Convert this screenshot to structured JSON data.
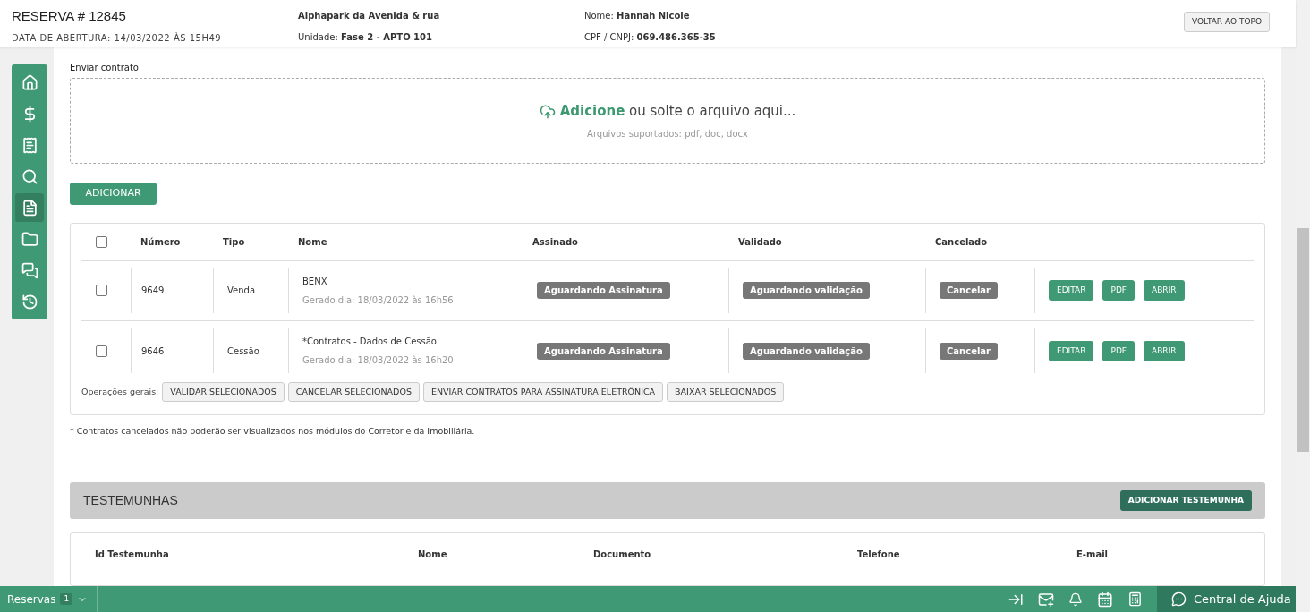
{
  "header": {
    "title": "RESERVA # 12845",
    "opened": "DATA DE ABERTURA: 14/03/2022 ÀS 15H49",
    "project": "Alphapark da Avenida & rua",
    "unit": "Unidade: **Fase 2 - APTO 101**",
    "client": "Nome: **Hannah Nicole**",
    "document": "CPF / CNPJ: **069.486.365-35**",
    "top_button": "VOLTAR AO TOPO"
  },
  "sidebar": {
    "items": [
      {
        "kind": "home",
        "selected": false
      },
      {
        "kind": "dollar",
        "selected": false
      },
      {
        "kind": "invoice",
        "selected": false
      },
      {
        "kind": "search",
        "selected": false
      },
      {
        "kind": "document",
        "selected": true
      },
      {
        "kind": "folder",
        "selected": false
      },
      {
        "kind": "chat",
        "selected": false
      },
      {
        "kind": "history",
        "selected": false
      }
    ]
  },
  "upload": {
    "label": "Enviar contrato",
    "prompt": "**Adicione** ou solte o arquivo aqui...",
    "hint": "Arquivos suportados: pdf, doc, docx"
  },
  "add_button": "ADICIONAR",
  "contracts": {
    "select_all": {
      "checked": false
    },
    "columns": [
      "Número",
      "Tipo",
      "Nome",
      "Assinado",
      "Validado",
      "Cancelado"
    ],
    "rows": [
      {
        "checked": false,
        "number": "9649",
        "type": "Venda",
        "name": "BENX",
        "generated": "Gerado dia: 18/03/2022 às 16h56",
        "signed": "Aguardando Assinatura",
        "validated": "Aguardando validação",
        "cancel": "Cancelar",
        "actions": [
          "EDITAR",
          "PDF",
          "ABRIR"
        ]
      },
      {
        "checked": false,
        "number": "9646",
        "type": "Cessão",
        "name": "*Contratos - Dados de Cessão",
        "generated": "Gerado dia: 18/03/2022 às 16h20",
        "signed": "Aguardando Assinatura",
        "validated": "Aguardando validação",
        "cancel": "Cancelar",
        "actions": [
          "EDITAR",
          "PDF",
          "ABRIR"
        ]
      }
    ],
    "operations_label": "Operações gerais:",
    "operations": [
      "VALIDAR SELECIONADOS",
      "CANCELAR SELECIONADOS",
      "ENVIAR CONTRATOS PARA ASSINATURA ELETRÔNICA",
      "BAIXAR SELECIONADOS"
    ]
  },
  "footnote": "* Contratos cancelados não poderão ser visualizados nos módulos do Corretor e da Imobiliária.",
  "witnesses": {
    "title": "TESTEMUNHAS",
    "button": "ADICIONAR TESTEMUNHA",
    "columns": [
      "Id Testemunha",
      "Nome",
      "Documento",
      "Telefone",
      "E-mail"
    ]
  },
  "bottom_bar": {
    "reservations": "Reservas",
    "count": "1",
    "help": "Central de Ajuda"
  }
}
